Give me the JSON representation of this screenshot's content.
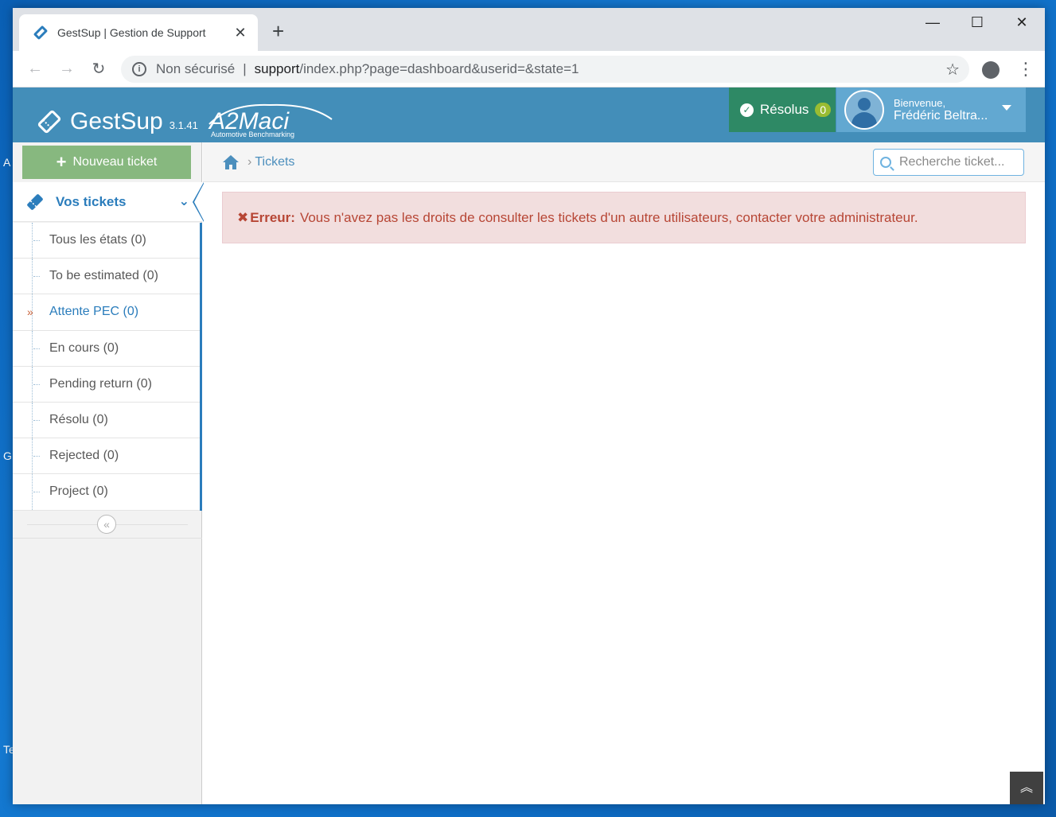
{
  "desktop": {
    "labels": [
      "A",
      "G",
      "Te"
    ]
  },
  "browser": {
    "tab_title": "GestSup | Gestion de Support",
    "tab_close": "✕",
    "new_tab": "+",
    "window_controls": {
      "minimize": "—",
      "maximize": "☐",
      "close": "✕"
    },
    "nav": {
      "back": "←",
      "forward": "→",
      "reload": "↻"
    },
    "security_label": "Non sécurisé",
    "url_host": "support",
    "url_path": "/index.php?page=dashboard&userid=&state=1",
    "star": "☆"
  },
  "header": {
    "app_name": "GestSup",
    "version": "3.1.41",
    "company_logo": "A2Maci",
    "company_tagline": "Automotive Benchmarking",
    "resolved_label": "Résolus",
    "resolved_count": "0",
    "welcome": "Bienvenue,",
    "user_name": "Frédéric Beltra..."
  },
  "sidebar": {
    "new_ticket": "Nouveau ticket",
    "section_title": "Vos tickets",
    "items": [
      {
        "label": "Tous les états (0)",
        "active": false
      },
      {
        "label": "To be estimated (0)",
        "active": false
      },
      {
        "label": "Attente PEC (0)",
        "active": true
      },
      {
        "label": "En cours (0)",
        "active": false
      },
      {
        "label": "Pending return (0)",
        "active": false
      },
      {
        "label": "Résolu (0)",
        "active": false
      },
      {
        "label": "Rejected (0)",
        "active": false
      },
      {
        "label": "Project (0)",
        "active": false
      }
    ],
    "collapse": "«"
  },
  "breadcrumb": {
    "sep": "›",
    "current": "Tickets"
  },
  "search": {
    "placeholder": "Recherche ticket..."
  },
  "alert": {
    "icon": "✖",
    "title": "Erreur:",
    "message": "Vous n'avez pas les droits de consulter les tickets d'un autre utilisateurs, contacter votre administrateur."
  },
  "scroll_top": "︽",
  "colors": {
    "header": "#438eb9",
    "accent": "#2b7dbc",
    "success": "#2e8965",
    "new_ticket": "#87b87f",
    "alert_bg": "#f2dede",
    "alert_text": "#b74635"
  }
}
